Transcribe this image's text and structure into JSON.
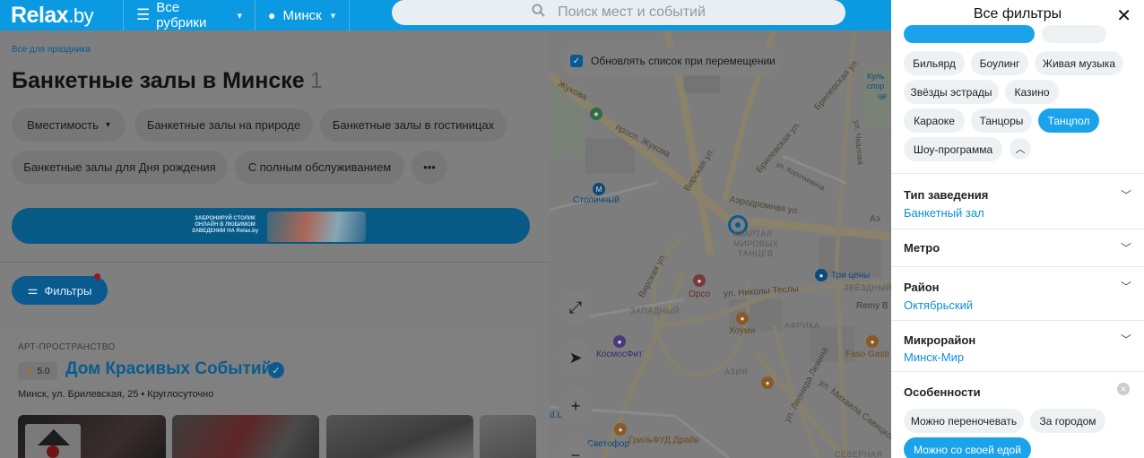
{
  "header": {
    "logo": "Relax",
    "logo_suffix": ".by",
    "rubrics_label": "Все рубрики",
    "city_label": "Минск",
    "search_placeholder": "Поиск мест и событий"
  },
  "listing": {
    "breadcrumb": "Все для праздника",
    "title": "Банкетные залы в Минске",
    "count": "1",
    "chips": [
      {
        "label": "Вместимость"
      },
      {
        "label": "Банкетные залы на природе"
      },
      {
        "label": "Банкетные залы в гостиницах"
      },
      {
        "label": "Банкетные залы для Дня рождения"
      },
      {
        "label": "С полным обслуживанием"
      },
      {
        "label": "•••"
      }
    ],
    "banner_text": "ЗАБРОНИРУЙ СТОЛИК ОНЛАЙН В ЛЮБИМОМ ЗАВЕДЕНИИ НА Relax.by",
    "filters_button": "Фильтры",
    "card": {
      "category": "АРТ-ПРОСТРАНСТВО",
      "rating": "5.0",
      "name": "Дом Красивых Событий",
      "address": "Минск, ул. Брилевская, 25",
      "hours": "Круглосуточно"
    }
  },
  "map": {
    "update_checkbox_label": "Обновлять список при перемещении",
    "labels": {
      "zhukova": "Жукова",
      "prosp_zhukova": "просп. Жукова",
      "brilevskaya": "Брилевская ул.",
      "brilevskaya2": "Брилевская ул.",
      "virskaya": "Вирская ул.",
      "virskaya2": "Вирская ул.",
      "aerodromnaya": "Аэродромная ул.",
      "aero2": "Аэ",
      "korotkevicha": "ул. Короткевича",
      "chkalova": "ул. Чкалова",
      "nikoly_tesly": "ул. Николы Теслы",
      "leonida_levina": "ул. Леонида Левина",
      "mikhaila": "ул. Михаила Савицкого",
      "stolichny": "Столичный",
      "kvartal1": "КВАРТАЛ",
      "kvartal2": "МИРОВЫХ",
      "kvartal3": "ТАНЦЕВ",
      "tri_ceny": "Три цены",
      "zvezdnyy": "ЗВЁЗДНЫЙ",
      "remy": "Remy B",
      "orso": "Орсо",
      "zapadnyy": "ЗАПАДНЫЙ",
      "khoumi": "Хоуми",
      "afrika": "АФРИКА",
      "kosmosfit": "КосмосФит",
      "azia": "АЗИЯ",
      "faso": "Faso Gastr",
      "grilfud": "ГрильФУД Драйв",
      "svetofor": "Светофор",
      "severnaya": "СЕВЕРНАЯ",
      "kult1": "Куль",
      "kult2": "спор",
      "kult3": "це",
      "dl": "d.L"
    }
  },
  "drawer": {
    "title": "Все фильтры",
    "tags": [
      {
        "label": "Бильярд",
        "on": false
      },
      {
        "label": "Боулинг",
        "on": false
      },
      {
        "label": "Живая музыка",
        "on": false
      },
      {
        "label": "Звёзды эстрады",
        "on": false
      },
      {
        "label": "Казино",
        "on": false
      },
      {
        "label": "Караоке",
        "on": false
      },
      {
        "label": "Танцоры",
        "on": false
      },
      {
        "label": "Танцпол",
        "on": true
      },
      {
        "label": "Шоу-программа",
        "on": false
      }
    ],
    "sections": [
      {
        "label": "Тип заведения",
        "value": "Банкетный зал"
      },
      {
        "label": "Метро",
        "value": ""
      },
      {
        "label": "Район",
        "value": "Октябрьский"
      },
      {
        "label": "Микрорайон",
        "value": "Минск-Мир"
      }
    ],
    "features": {
      "label": "Особенности",
      "tags": [
        {
          "label": "Можно переночевать",
          "on": false
        },
        {
          "label": "За городом",
          "on": false
        },
        {
          "label": "Можно со своей едой",
          "on": true
        }
      ]
    }
  },
  "colors": {
    "brand_blue": "#0b9ae2",
    "active_tag": "#1aa3ea",
    "link_blue": "#0b8fd8"
  }
}
